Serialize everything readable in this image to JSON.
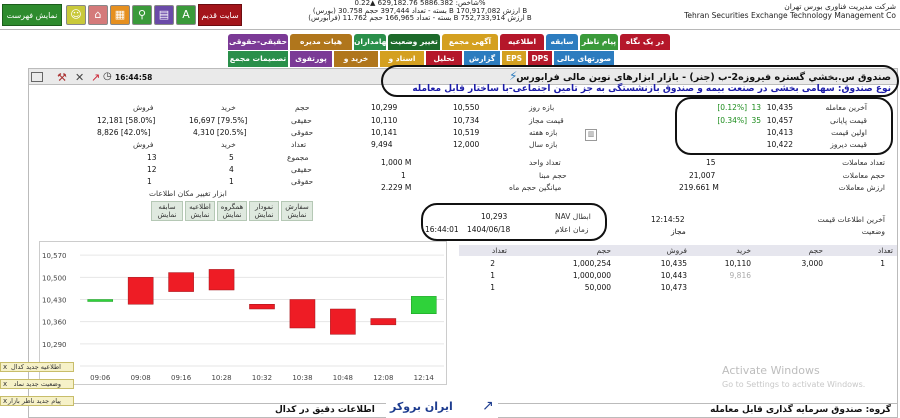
{
  "topbar": {
    "show_list_btn": "نمایش فهرست",
    "old_site_btn": "سایت قدیم",
    "ticker": [
      "شاخص: 5886.382 629,182.76 ▲0.22%",
      "(بورس) بسته - تعداد 397,444 حجم 30.758 B ارزش 170,917,082 B",
      "(فرابورس) بسته - تعداد 166,965 حجم 11.762 B ارزش 752,733,914 B"
    ],
    "company_fa": "شرکت مدیریت فناوری بورس تهران",
    "company_en": "Tehran Securities Exchange Technology Management Co",
    "icons": [
      "people-icon",
      "chart-icon",
      "search-icon",
      "grid-icon",
      "home-icon",
      "font-icon"
    ]
  },
  "tabs_row1": [
    "حقیقی-حقوقی",
    "هیات مدیره",
    "سهامداران",
    "تغییر وضعیت",
    "آگهی مجمع",
    "اطلاعیه",
    "سابقه",
    "پیام ناظر",
    "در یک نگاه"
  ],
  "tabs_row2": [
    "تصمیمات مجمع",
    "پورتفوی",
    "خرید و فروش",
    "اسناد و مدارک",
    "تحلیل",
    "گزارش",
    "EPS",
    "DPS",
    "صورتهای مالی"
  ],
  "panel": {
    "time": "16:44:58",
    "title": "صندوق س.بخشي گستره فيروزه2-ب (جنر) - بازار ابزارهای نوین مالی فرابورس",
    "subtitle": "نوع صندوق: سهامی بخشی در صنعت بیمه و صندوق بازنشستگی به جز تامین اجتماعی-با ساختار قابل معامله"
  },
  "prices": [
    {
      "label": "آخرین معامله",
      "value": "10,435",
      "chg": "13",
      "pct": "[0.12%]"
    },
    {
      "label": "قیمت پایانی",
      "value": "10,457",
      "chg": "35",
      "pct": "[0.34%]"
    },
    {
      "label": "اولین قیمت",
      "value": "10,413"
    },
    {
      "label": "قیمت دیروز",
      "value": "10,422"
    }
  ],
  "ranges": [
    {
      "label": "بازه روز",
      "low": "10,299",
      "high": "10,550"
    },
    {
      "label": "قیمت مجاز",
      "low": "10,110",
      "high": "10,734"
    },
    {
      "label": "بازه هفته",
      "low": "10,141",
      "high": "10,519"
    },
    {
      "label": "بازه سال",
      "low": "9,494",
      "high": "12,000"
    }
  ],
  "trade_stats": [
    {
      "label": "تعداد معاملات",
      "value": "15"
    },
    {
      "label": "حجم معاملات",
      "value": "21,007"
    },
    {
      "label": "ارزش معاملات",
      "value": "219.661 M"
    }
  ],
  "fund_stats": [
    {
      "label": "تعداد واحد",
      "value": "1,000 M"
    },
    {
      "label": "حجم مبنا",
      "value": "1"
    },
    {
      "label": "میانگین حجم ماه",
      "value": "2.229 M"
    }
  ],
  "last_info": {
    "label": "آخرین اطلاعات قیمت",
    "time": "12:14:52",
    "status_label": "وضعیت",
    "status": "مجاز"
  },
  "nav": {
    "label": "NAV ابطال",
    "value": "10,293",
    "date_label": "زمان اعلام",
    "date": "1404/06/18",
    "time": "16:44:01"
  },
  "hl": {
    "headers": [
      "فروش",
      "خرید",
      "حجم"
    ],
    "rows": [
      {
        "label": "حقیقی",
        "sell": "12,181 [58.0%]",
        "buy": "16,697 [79.5%]"
      },
      {
        "label": "حقوقی",
        "sell": "8,826 [42.0%]",
        "buy": "4,310 [20.5%]"
      }
    ],
    "headers2": [
      "فروش",
      "خرید",
      "تعداد"
    ],
    "rows2": [
      {
        "label": "مجموع",
        "sell": "13",
        "buy": "5"
      },
      {
        "label": "حقیقی",
        "sell": "12",
        "buy": "4"
      },
      {
        "label": "حقوقی",
        "sell": "1",
        "buy": "1"
      }
    ]
  },
  "tools": {
    "caption": "ابزار تغییر مکان اطلاعات",
    "buttons": [
      "سفارش نمایش",
      "نمودار نمایش",
      "همگروه نمایش",
      "اطلاعیه نمایش",
      "سابقه نمایش"
    ]
  },
  "orderbook": {
    "headers": [
      "تعداد",
      "حجم",
      "خرید",
      "فروش",
      "حجم",
      "تعداد"
    ],
    "rows": [
      [
        "1",
        "3,000",
        "10,110",
        "10,435",
        "1,000,254",
        "2"
      ],
      [
        "",
        "",
        "9,816",
        "10,443",
        "1,000,000",
        "1"
      ],
      [
        "",
        "",
        "",
        "10,473",
        "50,000",
        "1"
      ]
    ]
  },
  "chart_data": {
    "type": "candlestick",
    "categories": [
      "09:06",
      "09:08",
      "09:16",
      "10:28",
      "10:32",
      "10:38",
      "10:48",
      "12:08",
      "12:14"
    ],
    "candles": [
      {
        "open": 10430,
        "close": 10430
      },
      {
        "open": 10500,
        "close": 10415
      },
      {
        "open": 10515,
        "close": 10455
      },
      {
        "open": 10525,
        "close": 10460
      },
      {
        "open": 10415,
        "close": 10400
      },
      {
        "open": 10430,
        "close": 10340
      },
      {
        "open": 10400,
        "close": 10320
      },
      {
        "open": 10370,
        "close": 10350
      },
      {
        "open": 10385,
        "close": 10440
      }
    ],
    "ylim": [
      10220,
      10580
    ],
    "yticks": [
      "10,570",
      "10,500",
      "10,430",
      "10,360",
      "10,290",
      "10,220"
    ]
  },
  "toasts": [
    "اطلاعیه جدید کدال",
    "وضعیت جدید نماد",
    "پیام جدید ناظر بازار"
  ],
  "footer": {
    "left": "گروه: صندوق سرمایه گذاری قابل معامله",
    "mid": "اطلاعات دقیق در کدال"
  },
  "watermark": {
    "line1": "Activate Windows",
    "line2": "Go to Settings to activate Windows.",
    "logo": "ایران بروکر"
  }
}
